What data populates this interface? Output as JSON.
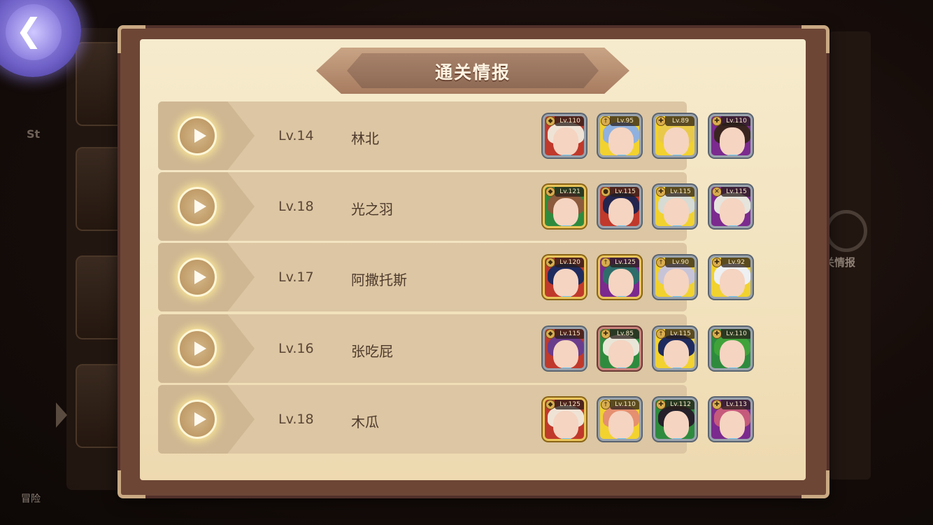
{
  "dialog": {
    "title": "通关情报"
  },
  "background": {
    "right_label": "关情报",
    "bottom_text": "冒险",
    "left_text": "St"
  },
  "icons": {
    "back": "back-arrow-icon",
    "play": "play-icon"
  },
  "colors": {
    "parchment": "#f2e2bd",
    "row": "#dcc6a3",
    "frame": "#6d4636",
    "title_plate": "#a77b5f"
  },
  "records": [
    {
      "level": "Lv.14",
      "name": "林北",
      "heroes": [
        {
          "lv": "Lv.110",
          "bg": "#c0392b",
          "hair": "#efe3d6",
          "frame": "silver",
          "class": "shield"
        },
        {
          "lv": "Lv.95",
          "bg": "#f2d22e",
          "hair": "#8fb1df",
          "frame": "silver",
          "class": "axe"
        },
        {
          "lv": "Lv.89",
          "bg": "#f2d22e",
          "hair": "#e9c94a",
          "frame": "silver",
          "class": "cross"
        },
        {
          "lv": "Lv.110",
          "bg": "#7b2a8e",
          "hair": "#3a2420",
          "frame": "silver",
          "class": "cross"
        }
      ]
    },
    {
      "level": "Lv.18",
      "name": "光之羽",
      "heroes": [
        {
          "lv": "Lv.121",
          "bg": "#2e8b3e",
          "hair": "#8c5a3c",
          "frame": "gold",
          "class": "shield"
        },
        {
          "lv": "Lv.115",
          "bg": "#c0392b",
          "hair": "#23254f",
          "frame": "silver",
          "class": "staff"
        },
        {
          "lv": "Lv.115",
          "bg": "#f2d22e",
          "hair": "#d6dbd4",
          "frame": "silver",
          "class": "cross"
        },
        {
          "lv": "Lv.115",
          "bg": "#7b2a8e",
          "hair": "#e6e4dd",
          "frame": "silver",
          "class": "bow"
        }
      ]
    },
    {
      "level": "Lv.17",
      "name": "阿撒托斯",
      "heroes": [
        {
          "lv": "Lv.120",
          "bg": "#c0392b",
          "hair": "#1f2b5e",
          "frame": "gold",
          "class": "shield"
        },
        {
          "lv": "Lv.125",
          "bg": "#7b2a8e",
          "hair": "#2d6d6a",
          "frame": "gold",
          "class": "axe"
        },
        {
          "lv": "Lv.90",
          "bg": "#f2d22e",
          "hair": "#c8c4d8",
          "frame": "silver",
          "class": "axe"
        },
        {
          "lv": "Lv.92",
          "bg": "#f2d22e",
          "hair": "#eef0f2",
          "frame": "silver",
          "class": "cross"
        }
      ]
    },
    {
      "level": "Lv.16",
      "name": "张吃屁",
      "heroes": [
        {
          "lv": "Lv.115",
          "bg": "#c0392b",
          "hair": "#6a3c8c",
          "frame": "silver",
          "class": "shield"
        },
        {
          "lv": "Lv.85",
          "bg": "#2e8b3e",
          "hair": "#e9e6d8",
          "frame": "bronze",
          "class": "cross"
        },
        {
          "lv": "Lv.115",
          "bg": "#f2d22e",
          "hair": "#1f2b5e",
          "frame": "silver",
          "class": "axe"
        },
        {
          "lv": "Lv.110",
          "bg": "#2e8b3e",
          "hair": "#3fa33a",
          "frame": "silver",
          "class": "cross"
        }
      ]
    },
    {
      "level": "Lv.18",
      "name": "木瓜",
      "heroes": [
        {
          "lv": "Lv.125",
          "bg": "#c0392b",
          "hair": "#efe3d6",
          "frame": "gold",
          "class": "shield"
        },
        {
          "lv": "Lv.110",
          "bg": "#f2d22e",
          "hair": "#e59070",
          "frame": "silver",
          "class": "axe"
        },
        {
          "lv": "Lv.112",
          "bg": "#2e8b3e",
          "hair": "#25202a",
          "frame": "silver",
          "class": "cross"
        },
        {
          "lv": "Lv.113",
          "bg": "#7b2a8e",
          "hair": "#c65a7c",
          "frame": "silver",
          "class": "cross"
        }
      ]
    }
  ]
}
